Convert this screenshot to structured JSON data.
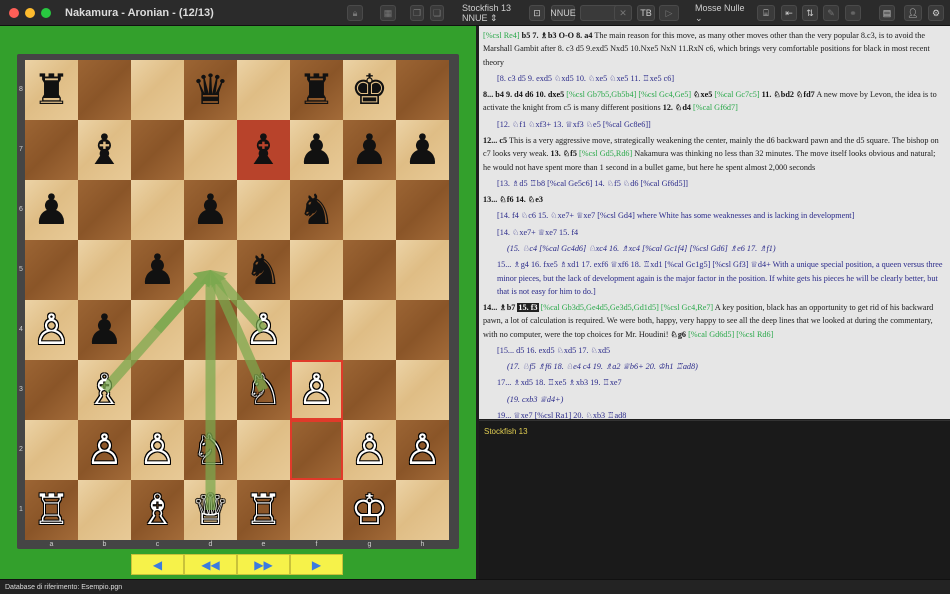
{
  "window": {
    "title": "Nakamura - Aronian - (12/13)"
  },
  "toolbar": {
    "engine_select": "Stockfish 13 NNUE ⇕",
    "nnue_label": "NNUE",
    "tb_label": "TB",
    "mode_select": "Mosse Nulle ⌄"
  },
  "board": {
    "files": [
      "a",
      "b",
      "c",
      "d",
      "e",
      "f",
      "g",
      "h"
    ],
    "ranks": [
      "8",
      "7",
      "6",
      "5",
      "4",
      "3",
      "2",
      "1"
    ],
    "pieces": [
      {
        "sq": "a8",
        "p": "r",
        "c": "b"
      },
      {
        "sq": "d8",
        "p": "q",
        "c": "b"
      },
      {
        "sq": "f8",
        "p": "r",
        "c": "b"
      },
      {
        "sq": "g8",
        "p": "k",
        "c": "b"
      },
      {
        "sq": "b7",
        "p": "b",
        "c": "b"
      },
      {
        "sq": "e7",
        "p": "b",
        "c": "b"
      },
      {
        "sq": "f7",
        "p": "p",
        "c": "b"
      },
      {
        "sq": "g7",
        "p": "p",
        "c": "b"
      },
      {
        "sq": "h7",
        "p": "p",
        "c": "b"
      },
      {
        "sq": "a6",
        "p": "p",
        "c": "b"
      },
      {
        "sq": "d6",
        "p": "p",
        "c": "b"
      },
      {
        "sq": "f6",
        "p": "n",
        "c": "b"
      },
      {
        "sq": "c5",
        "p": "p",
        "c": "b"
      },
      {
        "sq": "e5",
        "p": "n",
        "c": "b"
      },
      {
        "sq": "b4",
        "p": "p",
        "c": "b"
      },
      {
        "sq": "a4",
        "p": "p",
        "c": "w"
      },
      {
        "sq": "e4",
        "p": "p",
        "c": "w"
      },
      {
        "sq": "b3",
        "p": "b",
        "c": "w"
      },
      {
        "sq": "e3",
        "p": "n",
        "c": "w"
      },
      {
        "sq": "f3",
        "p": "p",
        "c": "w"
      },
      {
        "sq": "b2",
        "p": "p",
        "c": "w"
      },
      {
        "sq": "c2",
        "p": "p",
        "c": "w"
      },
      {
        "sq": "d2",
        "p": "n",
        "c": "w"
      },
      {
        "sq": "g2",
        "p": "p",
        "c": "w"
      },
      {
        "sq": "h2",
        "p": "p",
        "c": "w"
      },
      {
        "sq": "a1",
        "p": "r",
        "c": "w"
      },
      {
        "sq": "c1",
        "p": "b",
        "c": "w"
      },
      {
        "sq": "d1",
        "p": "q",
        "c": "w"
      },
      {
        "sq": "e1",
        "p": "r",
        "c": "w"
      },
      {
        "sq": "g1",
        "p": "k",
        "c": "w"
      }
    ],
    "highlight_red": [
      "e7"
    ],
    "highlight_outline": [
      "f3",
      "f2"
    ],
    "arrows": [
      {
        "from": "d5",
        "to": "b3"
      },
      {
        "from": "d5",
        "to": "c4"
      },
      {
        "from": "d5",
        "to": "d1"
      },
      {
        "from": "d5",
        "to": "e3"
      },
      {
        "from": "d5",
        "to": "e4"
      }
    ],
    "arrow_color": "#7aa84e",
    "highlight_color": "#b8432b"
  },
  "nav": [
    "◀",
    "◀◀",
    "▶▶",
    "▶"
  ],
  "notation": {
    "lines": [
      [
        {
          "t": "[%csl Re4] ",
          "k": "cmd"
        },
        {
          "t": "b5 7. ♗b3 O-O 8. a4",
          "k": "mv"
        },
        {
          "t": " The main reason for this move, as many other moves other than the very popular 8.c3, is to avoid the Marshall Gambit after 8. c3 d5 9.exd5 Nxd5 10.Nxe5 NxN 11.RxN c6, which brings very comfortable positions for black in most recent theory",
          "k": "tx"
        }
      ],
      [
        {
          "t": "[8. c3 d5 9. exd5 ♘xd5 10. ♘xe5 ♘xe5 11. ♖xe5 c6]",
          "k": "var"
        }
      ],
      [
        {
          "t": "8... b4 9. d4 d6 10. dxe5 ",
          "k": "mv"
        },
        {
          "t": "[%csl Gb7b5,Gb5b4] [%csl Gc4,Ge5] ",
          "k": "cmd"
        },
        {
          "t": "♘xe5 ",
          "k": "mv"
        },
        {
          "t": "[%cal Gc7c5] ",
          "k": "cmd"
        },
        {
          "t": "11. ♘bd2 ♘fd7",
          "k": "mv"
        },
        {
          "t": " A new move by Levon, the idea is to activate the knight from c5 is many different positions ",
          "k": "tx"
        },
        {
          "t": "12. ♘d4 ",
          "k": "mv"
        },
        {
          "t": "[%cal Gf6d7]",
          "k": "cmd"
        }
      ],
      [
        {
          "t": "[12. ♘f1 ♘xf3+ 13. ♕xf3 ♘e5 [%cal Gc8e6]]",
          "k": "var"
        }
      ],
      [
        {
          "t": "12... c5",
          "k": "mv"
        },
        {
          "t": " This is a very aggressive move, strategically weakening the center, mainly the d6 backward pawn and the d5 square. The bishop on c7 looks very weak. ",
          "k": "tx"
        },
        {
          "t": "13. ♘f5 ",
          "k": "mv"
        },
        {
          "t": "[%csl Gd5,Rd6]",
          "k": "cmd"
        },
        {
          "t": " Nakamura was thinking no less than 32 minutes. The move itself looks obvious and natural; he would not have spent more than 1 second in a bullet game, but here he spent almost 2,000 seconds",
          "k": "tx"
        }
      ],
      [
        {
          "t": "[13. ♗d5 ♖b8 [%cal Ge5c6] 14. ♘f5 ♘d6 [%cal Gf6d5]]",
          "k": "var"
        }
      ],
      [
        {
          "t": "13... ♘f6 14. ♘e3",
          "k": "mv"
        }
      ],
      [
        {
          "t": "[14. f4 ♘c6 15. ♘xe7+ ♕xe7 [%csl Gd4] where White has some weaknesses and is lacking in development]",
          "k": "var"
        }
      ],
      [
        {
          "t": "[14. ♘xe7+ ♕xe7 15. f4",
          "k": "var"
        }
      ],
      [
        {
          "t": "(15. ♘c4 [%cal Gc4d6] ♘xc4 16. ♗xc4 [%cal Gc1f4] [%csl Gd6] ♗e6 17. ♗f1)",
          "k": "var2"
        }
      ],
      [
        {
          "t": "15... ♗g4 16. fxe5 ♗xd1 17. exf6 ♕xf6 18. ♖xd1 [%cal Gc1g5] [%csl Gf3] ♕d4+ With a unique special position, a queen versus three minor pieces, but the lack of development again is the major factor in the position. If white gets his pieces he will be clearly better, but that is not easy for him to do.]",
          "k": "var"
        }
      ],
      [
        {
          "t": "14... ♗b7 ",
          "k": "mv"
        },
        {
          "t": "15. f3",
          "k": "cur"
        },
        {
          "t": " [%cal Gb3d5,Ge4d5,Ge3d5,Gd1d5] [%csl Gc4,Re7] ",
          "k": "cmd"
        },
        {
          "t": "A key position, black has an opportunity to get rid of his backward pawn, a lot of calculation is required. We were both, happy, very happy to see all the deep lines that we looked at during the commentary, with no computer, were the top choices for Mr. Houdini! ",
          "k": "tx"
        },
        {
          "t": "♘g6 ",
          "k": "mv"
        },
        {
          "t": "[%cal Gd6d5] [%csl Rd6]",
          "k": "cmd"
        }
      ],
      [
        {
          "t": "[15... d5 16. exd5 ♘xd5 17. ♘xd5",
          "k": "var"
        }
      ],
      [
        {
          "t": "(17. ♘f5 ♗f6 18. ♘e4 c4 19. ♗a2 ♕b6+ 20. ♔h1 ♖ad8)",
          "k": "var2"
        }
      ],
      [
        {
          "t": "17... ♗xd5 18. ♖xe5 ♗xb3 19. ♖xe7",
          "k": "var"
        }
      ],
      [
        {
          "t": "(19. cxb3 ♕d4+)",
          "k": "var2"
        }
      ],
      [
        {
          "t": "19... ♕xe7 [%csl Ra1] 20. ♘xb3 ♖ad8",
          "k": "var"
        }
      ],
      [
        {
          "t": "(20... c4 21. ♘d4 [%cal Gc2c3][%csl Gc3])",
          "k": "var2"
        }
      ],
      [
        {
          "t": "21. ♕f1 c4 And in this unbalanced position, chances are about equal. White is up material, but the key factor, once again, is the lack of development on white's side. The Rook on a1 and Bc1]",
          "k": "var"
        }
      ],
      [
        {
          "t": "16. ♘dc4",
          "k": "mv"
        }
      ],
      [
        {
          "t": "[16. ♘df1 ♖e8 17. ♘g3 ♗f8 18. ♘gf5 d5]",
          "k": "var"
        }
      ]
    ]
  },
  "engine": {
    "name": "Stockfish 13"
  },
  "status": {
    "text": "Database di riferimento: Esempio.pgn"
  }
}
